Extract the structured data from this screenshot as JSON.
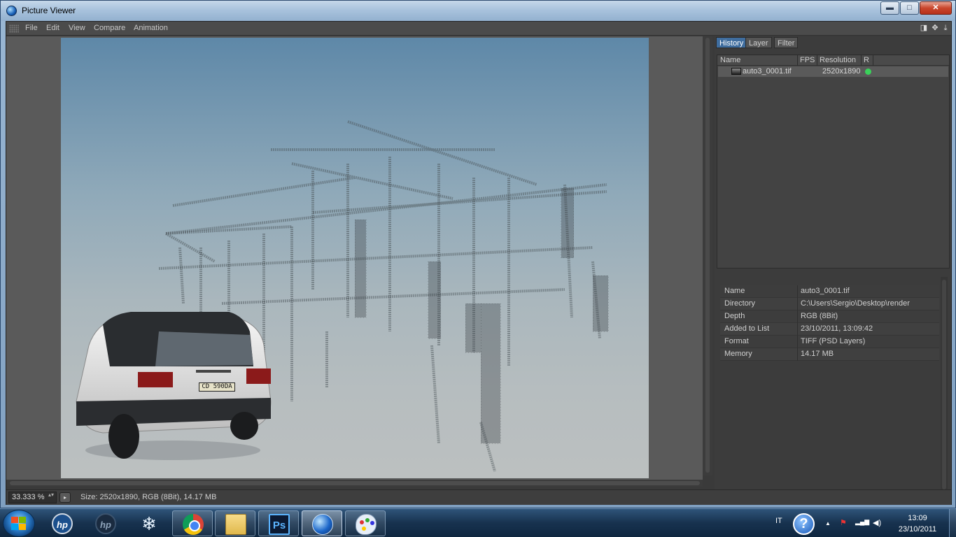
{
  "window": {
    "title": "Picture Viewer",
    "minimize_glyph": "▬",
    "maximize_glyph": "□",
    "close_glyph": "✕"
  },
  "menu": {
    "items": [
      "File",
      "Edit",
      "View",
      "Compare",
      "Animation"
    ],
    "toolbar_icons": [
      "panel-toggle-icon",
      "move-icon",
      "fit-icon"
    ],
    "toolbar_glyphs": [
      "◨",
      "✥",
      "⤓"
    ]
  },
  "viewer": {
    "license_plate": "CD 590DA",
    "image_description_icon": "render-image"
  },
  "panel": {
    "tabs": [
      "History",
      "Layer",
      "Filter"
    ],
    "active_tab": "History",
    "history": {
      "columns": [
        "Name",
        "FPS",
        "Resolution",
        "R"
      ],
      "rows": [
        {
          "name": "auto3_0001.tif",
          "fps": "",
          "resolution": "2520x1890",
          "status_color": "#3ad15a"
        }
      ]
    },
    "info": [
      {
        "key": "Name",
        "value": "auto3_0001.tif"
      },
      {
        "key": "Directory",
        "value": "C:\\Users\\Sergio\\Desktop\\render"
      },
      {
        "key": "Depth",
        "value": "RGB (8Bit)"
      },
      {
        "key": "Added to List",
        "value": "23/10/2011, 13:09:42"
      },
      {
        "key": "Format",
        "value": "TIFF (PSD Layers)"
      },
      {
        "key": "Memory",
        "value": "14.17 MB"
      }
    ]
  },
  "status": {
    "zoom": "33.333 %",
    "zoom_spin_glyph": "▴▾",
    "play_glyph": "▸",
    "text": "Size: 2520x1890, RGB (8Bit), 14.17 MB"
  },
  "taskbar": {
    "apps": [
      {
        "name": "hp-icon",
        "label": "hp",
        "state": "normal"
      },
      {
        "name": "hp-dark-icon",
        "label": "hp",
        "state": "normal"
      },
      {
        "name": "snowflake-icon",
        "label": "❄",
        "state": "normal"
      },
      {
        "name": "chrome-icon",
        "label": "",
        "state": "pinned"
      },
      {
        "name": "explorer-folder-icon",
        "label": "",
        "state": "pinned"
      },
      {
        "name": "photoshop-icon",
        "label": "Ps",
        "state": "pinned"
      },
      {
        "name": "cinema4d-icon",
        "label": "",
        "state": "active"
      },
      {
        "name": "paint-icon",
        "label": "",
        "state": "pinned"
      }
    ],
    "language": "IT",
    "help_glyph": "?",
    "tray_glyphs": [
      "▲",
      "⚑",
      "▂▄▆",
      "◀)"
    ],
    "time": "13:09",
    "date": "23/10/2011"
  },
  "colors": {
    "accent_tab": "#3f6d9e",
    "status_dot": "#3ad15a",
    "panel_bg": "#3c3c3c"
  }
}
